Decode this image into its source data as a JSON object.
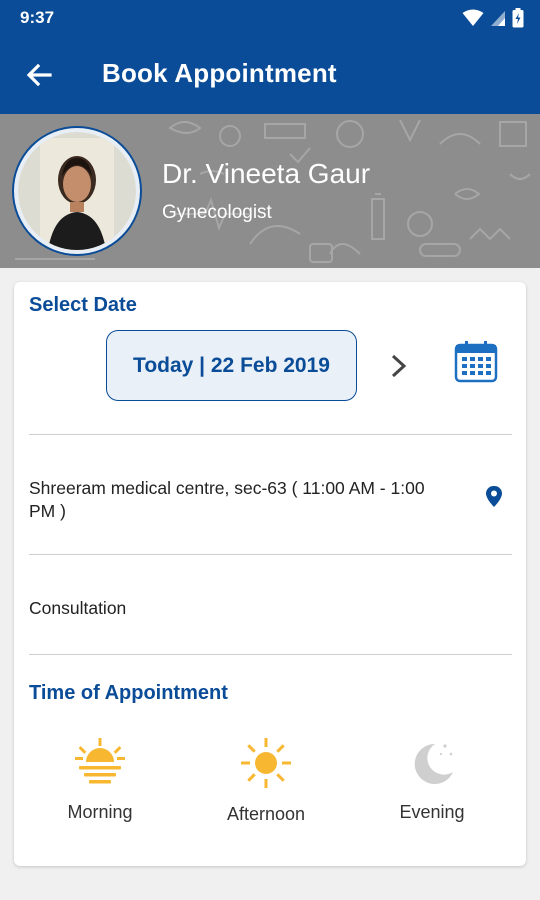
{
  "status_bar": {
    "time": "9:37"
  },
  "app_bar": {
    "title": "Book Appointment"
  },
  "doctor": {
    "name": "Dr. Vineeta Gaur",
    "specialty": "Gynecologist"
  },
  "select_date": {
    "title": "Select Date",
    "date_label": "Today | 22 Feb 2019"
  },
  "clinic": {
    "address": "Shreeram medical centre, sec-63 ( 11:00 AM - 1:00 PM )"
  },
  "consultation": {
    "label": "Consultation"
  },
  "time_of_appointment": {
    "title": "Time of Appointment",
    "options": [
      {
        "label": "Morning",
        "icon": "sunrise-icon"
      },
      {
        "label": "Afternoon",
        "icon": "sun-icon"
      },
      {
        "label": "Evening",
        "icon": "moon-icon"
      }
    ]
  },
  "colors": {
    "primary": "#0a4c97",
    "sun": "#f7b731",
    "moon": "#cfcfcf",
    "header_bg": "#8d8d8d"
  }
}
